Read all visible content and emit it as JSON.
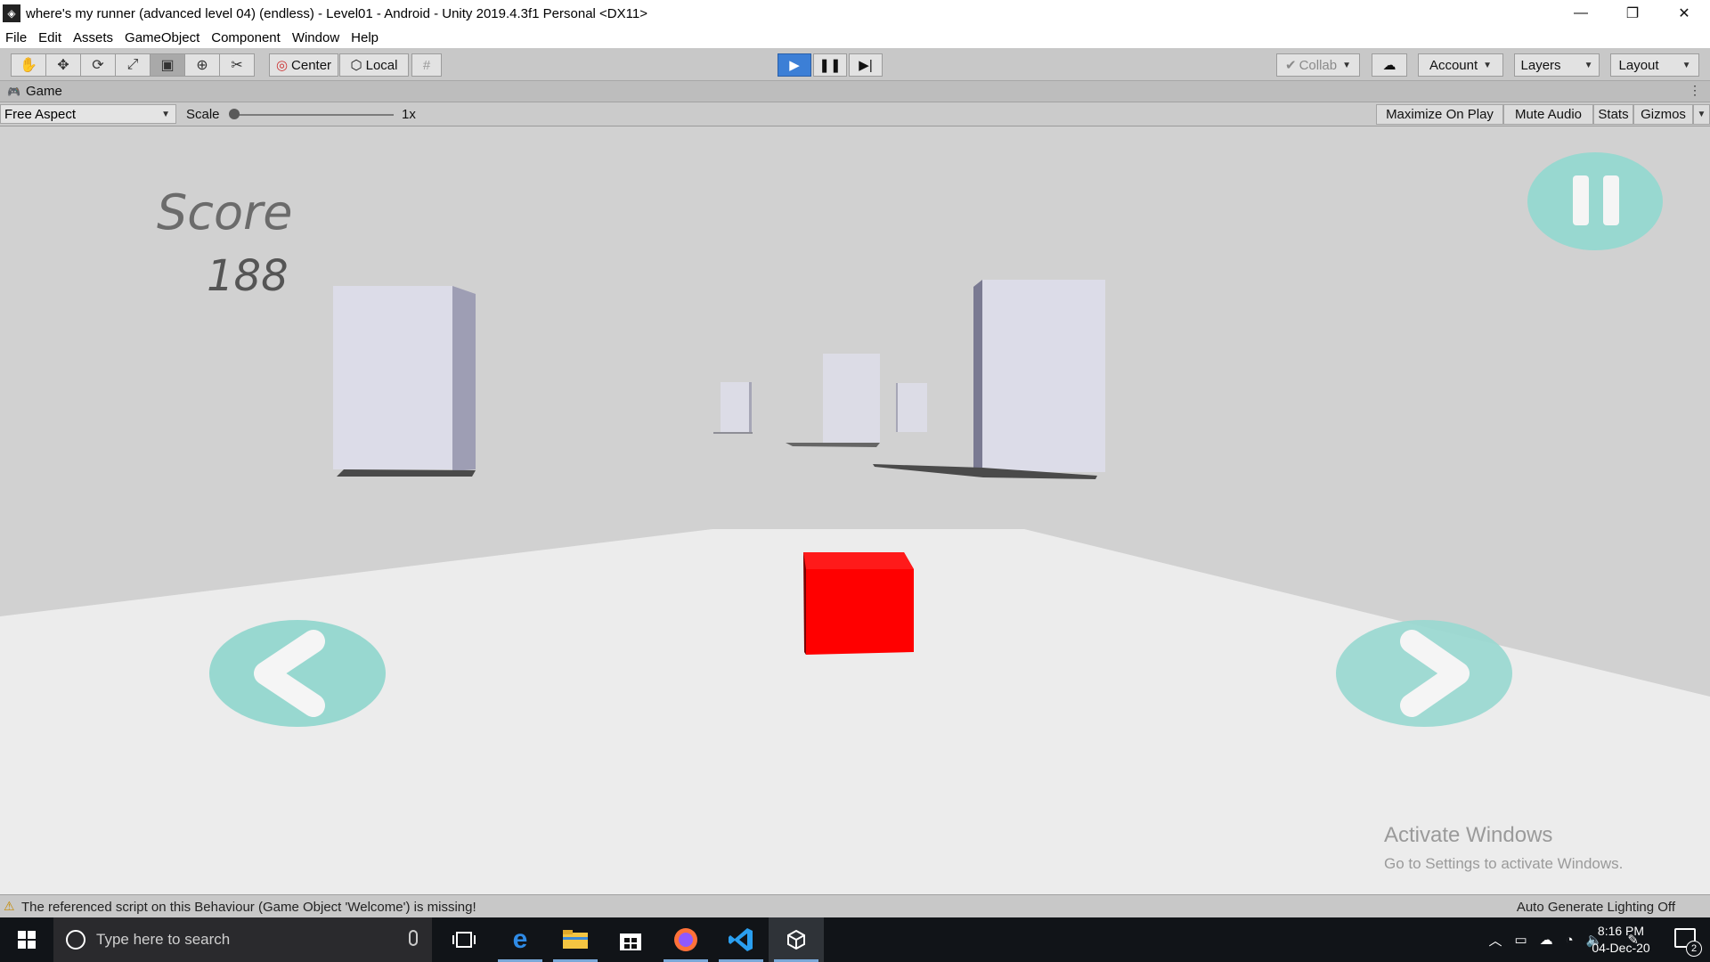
{
  "window": {
    "title": "where's my runner (advanced level 04) (endless) - Level01 - Android - Unity 2019.4.3f1 Personal <DX11>",
    "app_icon": "unity-icon",
    "minimize": "—",
    "restore": "❐",
    "close": "✕"
  },
  "menu": [
    "File",
    "Edit",
    "Assets",
    "GameObject",
    "Component",
    "Window",
    "Help"
  ],
  "toolbar": {
    "tools": [
      {
        "name": "hand-tool-icon",
        "glyph": "✋"
      },
      {
        "name": "move-tool-icon",
        "glyph": "✥"
      },
      {
        "name": "rotate-tool-icon",
        "glyph": "⟳"
      },
      {
        "name": "scale-tool-icon",
        "glyph": "⤢"
      },
      {
        "name": "rect-tool-icon",
        "glyph": "▣"
      },
      {
        "name": "transform-tool-icon",
        "glyph": "⊕"
      },
      {
        "name": "custom-tool-icon",
        "glyph": "✂"
      }
    ],
    "pivot_label": "Center",
    "space_label": "Local",
    "collab_label": "Collab",
    "account_label": "Account",
    "layers_label": "Layers",
    "layout_label": "Layout"
  },
  "game_tab": {
    "label": "Game",
    "aspect": "Free Aspect",
    "scale_label": "Scale",
    "scale_value": "1x",
    "maximize_on_play": "Maximize On Play",
    "mute_audio": "Mute Audio",
    "stats": "Stats",
    "gizmos": "Gizmos"
  },
  "game": {
    "score_label": "Score",
    "score_value": "188",
    "player_color": "#ff0000",
    "button_color": "#98d8d0",
    "watermark_title": "Activate Windows",
    "watermark_sub": "Go to Settings to activate Windows."
  },
  "status": {
    "warning": "The referenced script on this Behaviour (Game Object 'Welcome') is missing!",
    "lighting": "Auto Generate Lighting Off"
  },
  "taskbar": {
    "search_placeholder": "Type here to search",
    "time": "8:16 PM",
    "date": "04-Dec-20",
    "notification_count": "2"
  }
}
